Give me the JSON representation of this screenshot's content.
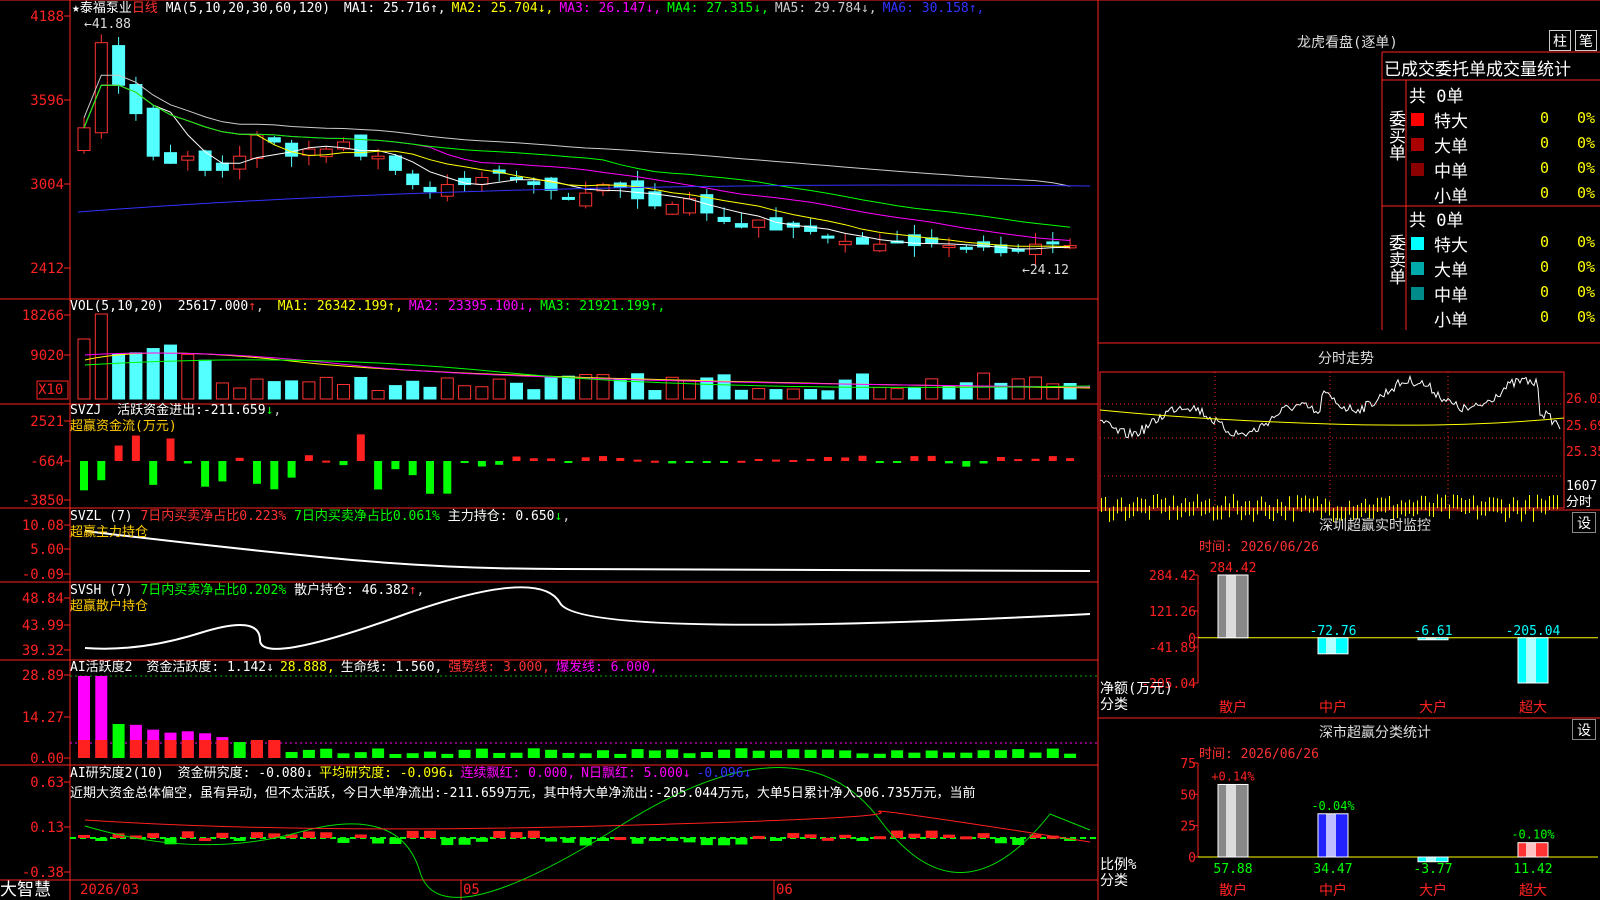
{
  "app": {
    "brand": "大智慧",
    "toolbar_right": [
      "柱",
      "笔"
    ]
  },
  "main": {
    "stock": "泰福泵业",
    "period": "日线",
    "ma_spec": "MA(5,10,20,30,60,120)",
    "ma_items": [
      {
        "label": "MA1:",
        "value": "25.716",
        "arrow": "↑",
        "color": "#ffffff"
      },
      {
        "label": "MA2:",
        "value": "25.704",
        "arrow": "↓",
        "color": "#ffff00"
      },
      {
        "label": "MA3:",
        "value": "26.147",
        "arrow": "↓",
        "color": "#ff00ff"
      },
      {
        "label": "MA4:",
        "value": "27.315",
        "arrow": "↓",
        "color": "#00ff00"
      },
      {
        "label": "MA5:",
        "value": "29.784",
        "arrow": "↓",
        "color": "#cccccc"
      },
      {
        "label": "MA6:",
        "value": "30.158",
        "arrow": "↑",
        "color": "#3333ff"
      }
    ],
    "y_ticks": [
      "4188",
      "3596",
      "3004",
      "2412"
    ],
    "hi_label": "41.88",
    "lo_label": "24.12",
    "x_labels": [
      "2026/03",
      "05",
      "06"
    ],
    "colors": {
      "up": "#ff3232",
      "down": "#54ffff",
      "axis": "#ff3333"
    }
  },
  "vol": {
    "spec": "VOL(5,10,20)",
    "value": "25617.000",
    "arrow": "↑",
    "ma": [
      {
        "label": "MA1:",
        "value": "26342.199",
        "arrow": "↑",
        "color": "#ffff00"
      },
      {
        "label": "MA2:",
        "value": "23395.100",
        "arrow": "↓",
        "color": "#ff00ff"
      },
      {
        "label": "MA3:",
        "value": "21921.199",
        "arrow": "↑",
        "color": "#00ff00"
      }
    ],
    "y_ticks": [
      "18266",
      "9020"
    ],
    "unit": "X10"
  },
  "svzj": {
    "spec": "SVZJ",
    "label": "活跃资金进出:",
    "value": "-211.659",
    "arrow": "↓",
    "subtitle": "超赢资金流(万元)",
    "y_ticks": [
      "2521",
      "-664",
      "-3850"
    ]
  },
  "svzl": {
    "spec": "SVZL (7)",
    "t1": "7日内买卖净占比0.223%",
    "t2": "7日内买卖净占比0.061%",
    "t3": "主力持仓: 0.650",
    "arrow": "↓",
    "subtitle": "超赢主力持仓",
    "y_ticks": [
      "10.08",
      "5.00",
      "-0.09"
    ]
  },
  "svsh": {
    "spec": "SVSH (7)",
    "t1": "7日内买卖净占比0.202%",
    "t2": "散户持仓: 46.382",
    "arrow": "↑",
    "subtitle": "超赢散户持仓",
    "y_ticks": [
      "48.84",
      "43.99",
      "39.32"
    ]
  },
  "ai2": {
    "spec": "AI活跃度2",
    "items": [
      {
        "t": "资金活跃度: 1.142",
        "a": "↓",
        "c": "#ffffff"
      },
      {
        "t": "28.888,",
        "a": "",
        "c": "#ffff00"
      },
      {
        "t": "生命线: 1.560,",
        "a": "",
        "c": "#ffffff"
      },
      {
        "t": "强势线: 3.000,",
        "a": "",
        "c": "#ff3232"
      },
      {
        "t": "爆发线: 6.000,",
        "a": "",
        "c": "#ff00ff"
      }
    ],
    "y_ticks": [
      "28.89",
      "14.27",
      "0.00"
    ]
  },
  "ai_res": {
    "spec": "AI研究度2(10)",
    "items": [
      {
        "t": "资金研究度: -0.080",
        "a": "↓",
        "c": "#ffffff"
      },
      {
        "t": "平均研究度: -0.096",
        "a": "↓",
        "c": "#ffff00"
      },
      {
        "t": "连续飘红: 0.000,",
        "a": "",
        "c": "#ff00ff"
      },
      {
        "t": "N日飘红: 5.000",
        "a": "↓",
        "c": "#ff00ff"
      },
      {
        "t": "-0.096",
        "a": "↓",
        "c": "#3333ff"
      }
    ],
    "text": "近期大资金总体偏空，虽有异动，但不太活跃，今日大单净流出:-211.659万元，其中特大单净流出:-205.044万元，大单5日累计净入506.735万元，当前",
    "y_ticks": [
      "0.63",
      "0.13",
      "-0.38"
    ]
  },
  "dragon": {
    "title": "龙虎看盘(逐单)",
    "header": "已成交委托单成交量统计",
    "buy_title": "委买单",
    "sell_title": "委卖单",
    "buy_total": "共 0单",
    "sell_total": "共 0单",
    "rows": [
      "特大",
      "大单",
      "中单",
      "小单"
    ],
    "counts": [
      "0",
      "0",
      "0",
      "0"
    ],
    "pcts": [
      "0%",
      "0%",
      "0%",
      "0%"
    ],
    "buy_colors": [
      "#ff0000",
      "#aa0000",
      "#8b0000",
      "#000000"
    ],
    "sell_colors": [
      "#00ffff",
      "#00aaaa",
      "#008b8b",
      "#000000"
    ]
  },
  "intraday": {
    "title": "分时走势",
    "right_ticks": [
      "26.03",
      "25.69",
      "25.35"
    ],
    "vol_tick": "1607",
    "vol_label": "分时"
  },
  "monitor": {
    "title": "深圳超赢实时监控",
    "set": "设",
    "time": "时间: 2026/06/26",
    "y_ticks": [
      "284.42",
      "121.26",
      "0",
      "-41.89",
      "-205.04"
    ],
    "ylabel": "净额(万元)",
    "xlabel": "分类",
    "cats": [
      "散户",
      "中户",
      "大户",
      "超大"
    ]
  },
  "classify": {
    "title": "深市超赢分类统计",
    "set": "设",
    "time": "时间: 2026/06/26",
    "y_ticks": [
      "75",
      "50",
      "25",
      "0"
    ],
    "ylabel": "比例%",
    "xlabel": "分类",
    "cats": [
      "散户",
      "中户",
      "大户",
      "超大"
    ]
  },
  "chart_data": [
    {
      "type": "bar",
      "title": "深圳超赢实时监控",
      "categories": [
        "散户",
        "中户",
        "大户",
        "超大"
      ],
      "values": [
        284.42,
        -72.76,
        -6.61,
        -205.04
      ],
      "ylim": [
        -205.04,
        284.42
      ],
      "ylabel": "净额(万元)",
      "xlabel": "分类"
    },
    {
      "type": "bar",
      "title": "深市超赢分类统计",
      "categories": [
        "散户",
        "中户",
        "大户",
        "超大"
      ],
      "values": [
        57.88,
        34.47,
        -3.77,
        11.42
      ],
      "top_labels": [
        "+0.14%",
        "-0.04%",
        "",
        "-0.10%"
      ],
      "ylim": [
        0,
        75
      ],
      "ylabel": "比例%",
      "xlabel": "分类"
    }
  ]
}
